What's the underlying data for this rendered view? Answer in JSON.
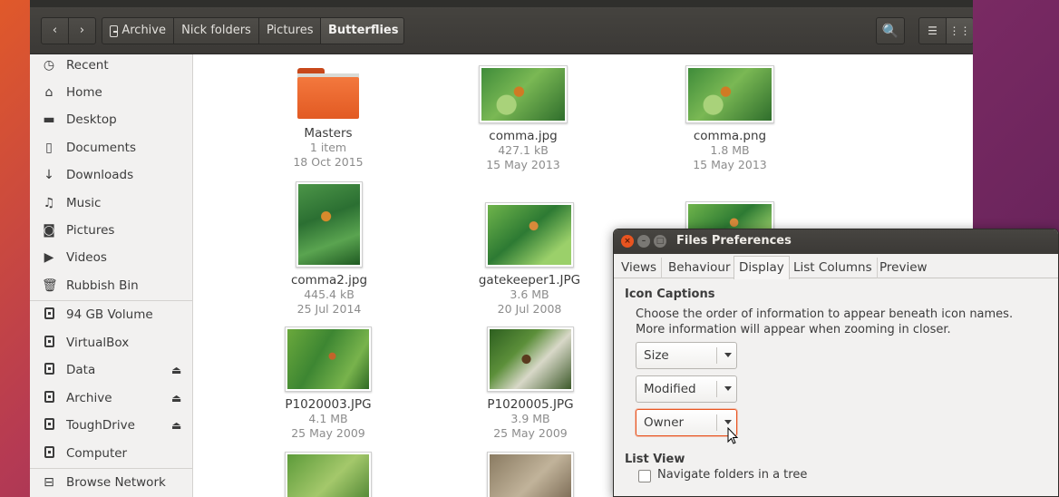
{
  "toolbar": {
    "back_label": "‹",
    "forward_label": "›",
    "breadcrumbs": [
      "Archive",
      "Nick folders",
      "Pictures",
      "Butterflies"
    ],
    "search_icon": "🔍",
    "list_view_icon": "☰",
    "grid_view_icon": "⋮⋮"
  },
  "sidebar": {
    "places": [
      {
        "label": "Recent",
        "icon": "clock-icon",
        "glyph": "◷"
      },
      {
        "label": "Home",
        "icon": "home-icon",
        "glyph": "⌂"
      },
      {
        "label": "Desktop",
        "icon": "desktop-folder-icon",
        "glyph": "▬"
      },
      {
        "label": "Documents",
        "icon": "document-icon",
        "glyph": "▯"
      },
      {
        "label": "Downloads",
        "icon": "download-icon",
        "glyph": "↓"
      },
      {
        "label": "Music",
        "icon": "music-icon",
        "glyph": "♫"
      },
      {
        "label": "Pictures",
        "icon": "camera-icon",
        "glyph": "◙"
      },
      {
        "label": "Videos",
        "icon": "video-icon",
        "glyph": "▶"
      },
      {
        "label": "Rubbish Bin",
        "icon": "trash-icon",
        "glyph": "🗑"
      }
    ],
    "devices": [
      {
        "label": "94 GB Volume",
        "eject": false
      },
      {
        "label": "VirtualBox",
        "eject": false
      },
      {
        "label": "Data",
        "eject": true
      },
      {
        "label": "Archive",
        "eject": true
      },
      {
        "label": "ToughDrive",
        "eject": true
      },
      {
        "label": "Computer",
        "eject": false
      }
    ],
    "network": {
      "label": "Browse Network",
      "glyph": "⊟"
    },
    "eject_glyph": "⏏"
  },
  "files": [
    {
      "name": "Masters",
      "line1": "1 item",
      "line2": "18 Oct 2015",
      "type": "folder"
    },
    {
      "name": "comma.jpg",
      "line1": "427.1 kB",
      "line2": "15 May 2013",
      "type": "image"
    },
    {
      "name": "comma.png",
      "line1": "1.8 MB",
      "line2": "15 May 2013",
      "type": "image"
    },
    {
      "name": "comma2.jpg",
      "line1": "445.4 kB",
      "line2": "25 Jul 2014",
      "type": "image"
    },
    {
      "name": "gatekeeper1.JPG",
      "line1": "3.6 MB",
      "line2": "20 Jul 2008",
      "type": "image"
    },
    {
      "name": "P1020003.JPG",
      "line1": "4.1 MB",
      "line2": "25 May 2009",
      "type": "image"
    },
    {
      "name": "P1020005.JPG",
      "line1": "3.9 MB",
      "line2": "25 May 2009",
      "type": "image"
    }
  ],
  "dialog": {
    "title": "Files Preferences",
    "close_glyph": "×",
    "min_glyph": "–",
    "max_glyph": "□",
    "tabs": [
      "Views",
      "Behaviour",
      "Display",
      "List Columns",
      "Preview"
    ],
    "active_tab": "Display",
    "icon_captions_heading": "Icon Captions",
    "icon_captions_desc_1": "Choose the order of information to appear beneath icon names.",
    "icon_captions_desc_2": "More information will appear when zooming in closer.",
    "captions": [
      "Size",
      "Modified",
      "Owner"
    ],
    "list_view_heading": "List View",
    "navigate_tree_label": "Navigate folders in a tree",
    "navigate_tree_checked": false
  },
  "colors": {
    "accent": "#e95420",
    "toolbar": "#3f3d3a",
    "sidebar": "#f2f1f0"
  }
}
